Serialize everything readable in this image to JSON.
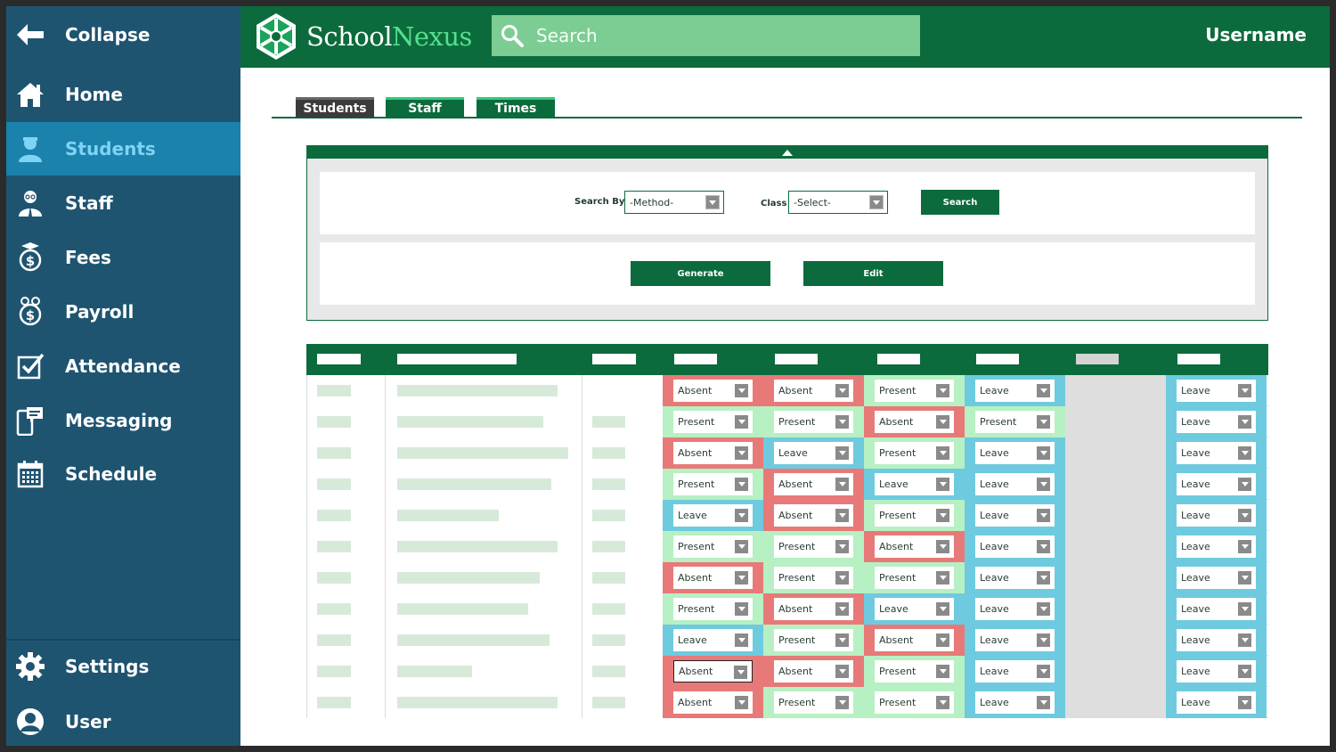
{
  "sidebar": {
    "collapse_label": "Collapse",
    "items": [
      {
        "label": "Home",
        "icon": "home-icon"
      },
      {
        "label": "Students",
        "icon": "student-icon",
        "active": true
      },
      {
        "label": "Staff",
        "icon": "staff-icon"
      },
      {
        "label": "Fees",
        "icon": "fees-icon"
      },
      {
        "label": "Payroll",
        "icon": "payroll-icon"
      },
      {
        "label": "Attendance",
        "icon": "attendance-icon"
      },
      {
        "label": "Messaging",
        "icon": "messaging-icon"
      },
      {
        "label": "Schedule",
        "icon": "calendar-icon"
      }
    ],
    "bottom_items": [
      {
        "label": "Settings",
        "icon": "gear-icon"
      },
      {
        "label": "User",
        "icon": "user-icon"
      }
    ]
  },
  "header": {
    "logo_part1": "School",
    "logo_part2": "Nexus",
    "search_placeholder": "Search",
    "username": "Username"
  },
  "tabs": [
    {
      "label": "Students",
      "active": true
    },
    {
      "label": "Staff"
    },
    {
      "label": "Times"
    }
  ],
  "filters": {
    "search_by_label": "Search By",
    "method_value": "-Method-",
    "class_label": "Class",
    "class_value": "-Select-",
    "search_button": "Search",
    "generate_button": "Generate",
    "edit_button": "Edit"
  },
  "table": {
    "rows": [
      [
        "Absent",
        "Absent",
        "Present",
        "Leave",
        "Leave"
      ],
      [
        "Present",
        "Present",
        "Absent",
        "Present",
        "Leave"
      ],
      [
        "Absent",
        "Leave",
        "Present",
        "Leave",
        "Leave"
      ],
      [
        "Present",
        "Absent",
        "Leave",
        "Leave",
        "Leave"
      ],
      [
        "Leave",
        "Absent",
        "Present",
        "Leave",
        "Leave"
      ],
      [
        "Present",
        "Present",
        "Absent",
        "Leave",
        "Leave"
      ],
      [
        "Absent",
        "Present",
        "Present",
        "Leave",
        "Leave"
      ],
      [
        "Present",
        "Absent",
        "Leave",
        "Leave",
        "Leave"
      ],
      [
        "Leave",
        "Present",
        "Absent",
        "Leave",
        "Leave"
      ],
      [
        "Absent",
        "Absent",
        "Present",
        "Leave",
        "Leave"
      ],
      [
        "Absent",
        "Present",
        "Present",
        "Leave",
        "Leave"
      ]
    ]
  },
  "colors": {
    "brand_green": "#0c6b3c",
    "sidebar_blue": "#1e5470",
    "active_blue": "#1b82ab",
    "absent": "#e77a78",
    "present": "#b6f0c3",
    "leave": "#6ecadf"
  }
}
